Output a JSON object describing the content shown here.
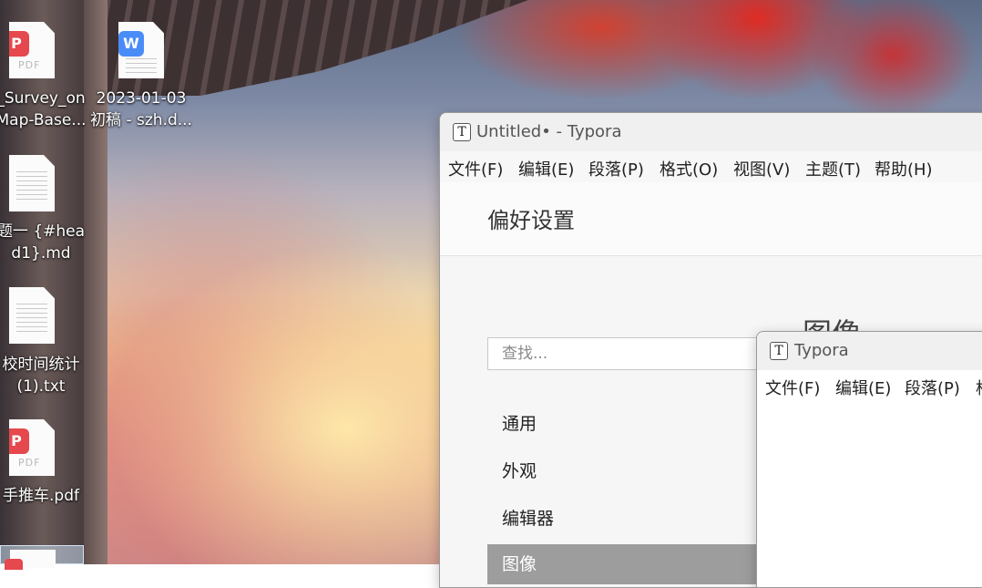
{
  "desktop": {
    "icons": [
      {
        "type": "pdf",
        "line1": "_Survey_on",
        "line2": "Map-Base..."
      },
      {
        "type": "word",
        "line1": "2023-01-03",
        "line2": "初稿 - szh.d..."
      },
      {
        "type": "txt",
        "line1": "题一 {#hea",
        "line2": "d1}.md"
      },
      {
        "type": "txt",
        "line1": "校时间统计",
        "line2": "(1).txt"
      },
      {
        "type": "pdf",
        "line1": "手推车.pdf",
        "line2": ""
      }
    ]
  },
  "window_main": {
    "title": "Untitled• - Typora",
    "menu": [
      "文件(F)",
      "编辑(E)",
      "段落(P)",
      "格式(O)",
      "视图(V)",
      "主题(T)",
      "帮助(H)"
    ],
    "pref_title": "偏好设置",
    "search_placeholder": "查找...",
    "nav": [
      "通用",
      "外观",
      "编辑器",
      "图像"
    ],
    "active_nav": "图像",
    "section_title": "图像"
  },
  "window_second": {
    "title": "Typora",
    "menu": [
      "文件(F)",
      "编辑(E)",
      "段落(P)",
      "格"
    ]
  },
  "colors": {
    "pdf_badge": "#e5484d",
    "word_badge": "#4a8cf7",
    "active_nav_bg": "#9d9d9d"
  }
}
